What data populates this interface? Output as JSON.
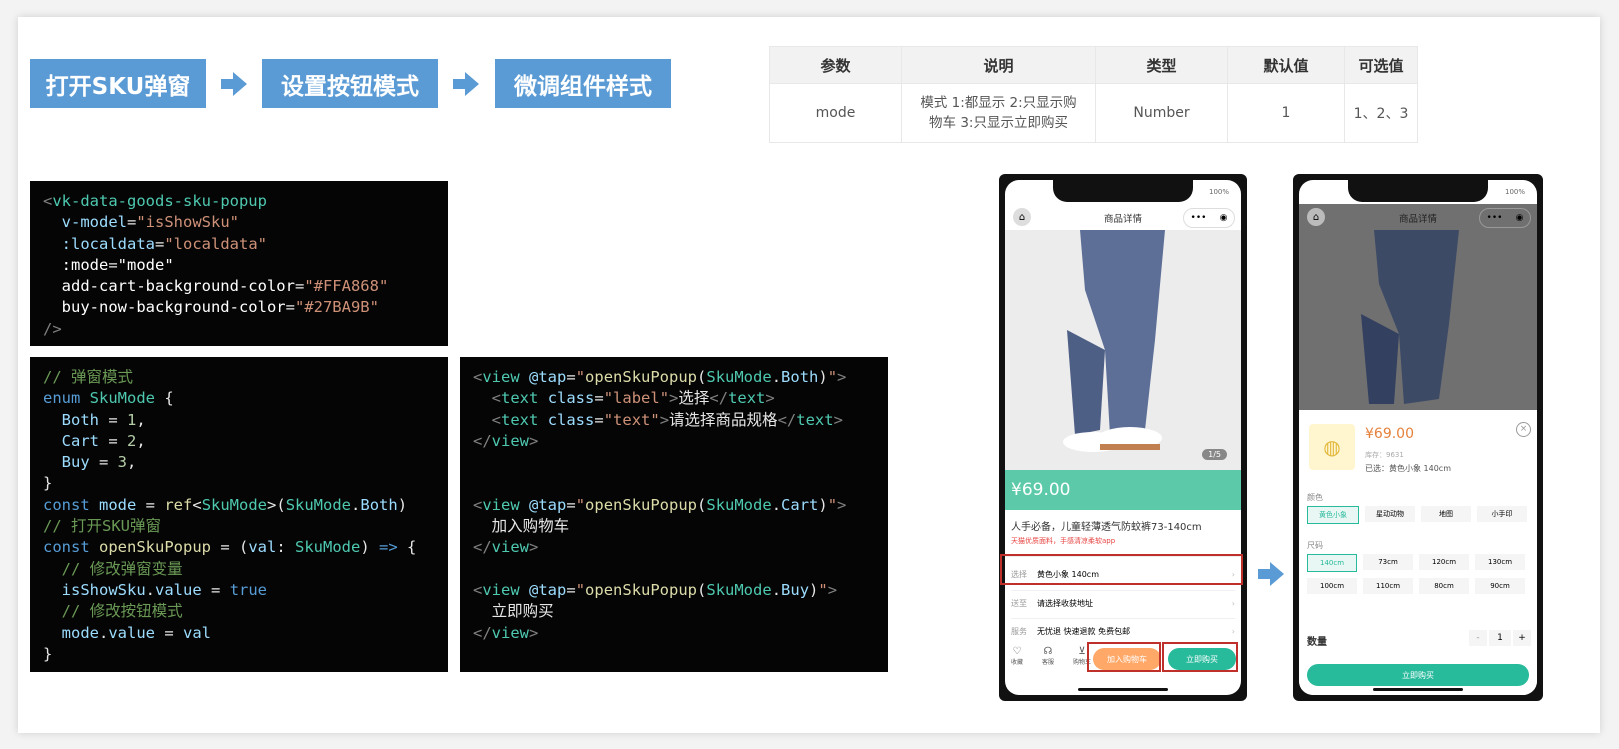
{
  "steps": [
    "打开SKU弹窗",
    "设置按钮模式",
    "微调组件样式"
  ],
  "param_table": {
    "headers": [
      "参数",
      "说明",
      "类型",
      "默认值",
      "可选值"
    ],
    "rows": [
      {
        "param": "mode",
        "desc1": "模式 1:都显示 2:只显示购",
        "desc2": "物车 3:只显示立即购买",
        "type": "Number",
        "default": "1",
        "options": "1、2、3"
      }
    ]
  },
  "code1": [
    "<vk-data-goods-sku-popup",
    "  v-model=\"isShowSku\"",
    "  :localdata=\"localdata\"",
    "  :mode=\"mode\"",
    "  add-cart-background-color=\"#FFA868\"",
    "  buy-now-background-color=\"#27BA9B\"",
    "/>"
  ],
  "code2": [
    "// 弹窗模式",
    "enum SkuMode {",
    "  Both = 1,",
    "  Cart = 2,",
    "  Buy = 3,",
    "}",
    "const mode = ref<SkuMode>(SkuMode.Both)",
    "// 打开SKU弹窗",
    "const openSkuPopup = (val: SkuMode) => {",
    "  // 修改弹窗变量",
    "  isShowSku.value = true",
    "  // 修改按钮模式",
    "  mode.value = val",
    "}"
  ],
  "code3": [
    "<view @tap=\"openSkuPopup(SkuMode.Both)\">",
    "  <text class=\"label\">选择</text>",
    "  <text class=\"text\">请选择商品规格</text>",
    "</view>",
    "",
    "",
    "<view @tap=\"openSkuPopup(SkuMode.Cart)\">",
    "  加入购物车",
    "</view>",
    "",
    "<view @tap=\"openSkuPopup(SkuMode.Buy)\">",
    "  立即购买",
    "</view>"
  ],
  "phone1": {
    "battery": "100%",
    "title": "商品详情",
    "page_indicator": "1/5",
    "price": "¥69.00",
    "product_name": "人手必备，儿童轻薄透气防蚊裤73-140cm",
    "product_sub": "天猫优质面料，手感清凉柔软app",
    "rows": [
      {
        "label": "选择",
        "value": "黄色小象 140cm"
      },
      {
        "label": "送至",
        "value": "请选择收获地址"
      },
      {
        "label": "服务",
        "value": "无忧退 快速退款 免费包邮"
      }
    ],
    "bottom_icons": [
      "收藏",
      "客服",
      "购物车"
    ],
    "cart_button": "加入购物车",
    "buy_button": "立即购买",
    "colors": {
      "accent": "#5ccaa9",
      "cart": "#ffa868",
      "buy": "#27ba9b"
    }
  },
  "phone2": {
    "battery": "100%",
    "title": "商品详情",
    "price": "¥69.00",
    "stock": "库存：9631",
    "selected": "已选：黄色小象 140cm",
    "color_label": "颜色",
    "colors_opts": [
      "黄色小象",
      "星动动物",
      "地图",
      "小手印"
    ],
    "size_label": "尺码",
    "sizes": [
      "140cm",
      "73cm",
      "120cm",
      "130cm",
      "100cm",
      "110cm",
      "80cm",
      "90cm"
    ],
    "qty_label": "数量",
    "qty": "1",
    "minus": "-",
    "plus": "+",
    "buy_button": "立即购买"
  }
}
